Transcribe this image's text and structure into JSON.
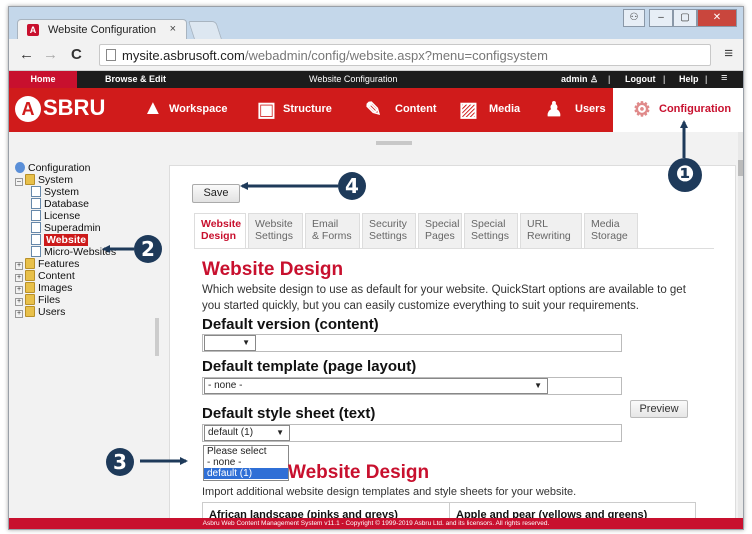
{
  "browser": {
    "tab_title": "Website Configuration",
    "tab_close": "×",
    "url_host": "mysite.asbrusoft.com",
    "url_path": "/webadmin/config/website.aspx?menu=configsystem",
    "back": "←",
    "forward": "→",
    "reload": "C",
    "menu": "≡",
    "window_controls": [
      "⚇",
      "–",
      "▢",
      "✕"
    ]
  },
  "topbar": {
    "home": "Home",
    "browse_edit": "Browse & Edit",
    "center": "Website Configuration",
    "user": "admin ♙",
    "sep": "|",
    "logout": "Logout",
    "help": "Help",
    "menu": "≡"
  },
  "brand": {
    "logo_letter": "A",
    "logo_text": "SBRU"
  },
  "mainnav": [
    {
      "label": "Workspace",
      "icon": "workspace-icon",
      "glyph": "▲"
    },
    {
      "label": "Structure",
      "icon": "structure-icon",
      "glyph": "▣"
    },
    {
      "label": "Content",
      "icon": "content-icon",
      "glyph": "✎"
    },
    {
      "label": "Media",
      "icon": "media-icon",
      "glyph": "▨"
    },
    {
      "label": "Users",
      "icon": "users-icon",
      "glyph": "♟"
    },
    {
      "label": "Configuration",
      "icon": "gear-icon",
      "glyph": "⚙"
    }
  ],
  "tree": {
    "root": "Configuration",
    "system": "System",
    "system_children": [
      "System",
      "Database",
      "License",
      "Superadmin",
      "Website",
      "Micro-Websites"
    ],
    "selected": "Website",
    "others": [
      "Features",
      "Content",
      "Images",
      "Files",
      "Users"
    ]
  },
  "panel": {
    "save": "Save",
    "tabs": [
      {
        "l1": "Website",
        "l2": "Design"
      },
      {
        "l1": "Website",
        "l2": "Settings"
      },
      {
        "l1": "Email",
        "l2": "& Forms"
      },
      {
        "l1": "Security",
        "l2": "Settings"
      },
      {
        "l1": "Special",
        "l2": "Pages"
      },
      {
        "l1": "Special",
        "l2": "Settings"
      },
      {
        "l1": "URL",
        "l2": "Rewriting"
      },
      {
        "l1": "Media",
        "l2": "Storage"
      }
    ],
    "heading": "Website Design",
    "description": "Which website design to use as default for your website. QuickStart options are available to get you started quickly, but you can easily customize everything to suit your requirements.",
    "default_version_label": "Default version (content)",
    "default_version_value": "",
    "default_template_label": "Default template (page layout)",
    "default_template_value": "- none -",
    "preview": "Preview",
    "default_stylesheet_label": "Default style sheet (text)",
    "default_stylesheet_value": "default (1)",
    "stylesheet_options": [
      "Please select",
      "- none -",
      "default (1)"
    ],
    "import_heading": "Website Design",
    "import_description": "Import additional website design templates and style sheets for your website.",
    "themes": [
      "African landscape (pinks and greys)",
      "Apple and pear (yellows and greens)"
    ]
  },
  "footer": "Asbru Web Content Management System v11.1 - Copyright © 1999-2019 Asbru Ltd. and its licensors. All rights reserved.",
  "callouts": [
    "❶",
    "2",
    "3",
    "4"
  ],
  "colors": {
    "brand_red": "#d01b1b",
    "callout_navy": "#1e3a5a",
    "selected_blue": "#2f6fd6"
  }
}
